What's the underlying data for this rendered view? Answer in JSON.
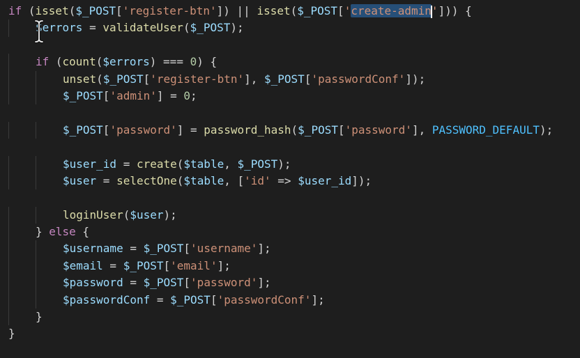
{
  "theme": {
    "background": "#1e1e1e",
    "keyword": "#c586c0",
    "function": "#dcdcaa",
    "variable": "#9cdcfe",
    "string": "#ce9178",
    "number": "#b5cea8",
    "constant": "#4fc1ff",
    "selection": "#264f78"
  },
  "cursor_icon": "text-ibeam-cursor-icon",
  "lines": [
    {
      "indent": 0,
      "tokens": [
        {
          "t": "kw",
          "v": "if"
        },
        {
          "t": "punc",
          "v": " ("
        },
        {
          "t": "fn",
          "v": "isset"
        },
        {
          "t": "punc",
          "v": "("
        },
        {
          "t": "var",
          "v": "$_POST"
        },
        {
          "t": "punc",
          "v": "["
        },
        {
          "t": "str",
          "v": "'register-btn'"
        },
        {
          "t": "punc",
          "v": "]) || "
        },
        {
          "t": "fn",
          "v": "isset"
        },
        {
          "t": "punc",
          "v": "("
        },
        {
          "t": "var",
          "v": "$_POST"
        },
        {
          "t": "punc",
          "v": "["
        },
        {
          "t": "str",
          "v": "'"
        },
        {
          "t": "sel",
          "v": "create-admin"
        },
        {
          "t": "caret",
          "v": ""
        },
        {
          "t": "str",
          "v": "'"
        },
        {
          "t": "punc",
          "v": "])) {"
        }
      ]
    },
    {
      "indent": 1,
      "tokens": [
        {
          "t": "var",
          "v": "$errors"
        },
        {
          "t": "punc",
          "v": " = "
        },
        {
          "t": "fn",
          "v": "validateUser"
        },
        {
          "t": "punc",
          "v": "("
        },
        {
          "t": "var",
          "v": "$_POST"
        },
        {
          "t": "punc",
          "v": ");"
        }
      ]
    },
    {
      "indent": 0,
      "tokens": []
    },
    {
      "indent": 1,
      "tokens": [
        {
          "t": "kw",
          "v": "if"
        },
        {
          "t": "punc",
          "v": " ("
        },
        {
          "t": "fn",
          "v": "count"
        },
        {
          "t": "punc",
          "v": "("
        },
        {
          "t": "var",
          "v": "$errors"
        },
        {
          "t": "punc",
          "v": ") === "
        },
        {
          "t": "num",
          "v": "0"
        },
        {
          "t": "punc",
          "v": ") {"
        }
      ]
    },
    {
      "indent": 2,
      "tokens": [
        {
          "t": "fn",
          "v": "unset"
        },
        {
          "t": "punc",
          "v": "("
        },
        {
          "t": "var",
          "v": "$_POST"
        },
        {
          "t": "punc",
          "v": "["
        },
        {
          "t": "str",
          "v": "'register-btn'"
        },
        {
          "t": "punc",
          "v": "], "
        },
        {
          "t": "var",
          "v": "$_POST"
        },
        {
          "t": "punc",
          "v": "["
        },
        {
          "t": "str",
          "v": "'passwordConf'"
        },
        {
          "t": "punc",
          "v": "]);"
        }
      ]
    },
    {
      "indent": 2,
      "tokens": [
        {
          "t": "var",
          "v": "$_POST"
        },
        {
          "t": "punc",
          "v": "["
        },
        {
          "t": "str",
          "v": "'admin'"
        },
        {
          "t": "punc",
          "v": "] = "
        },
        {
          "t": "num",
          "v": "0"
        },
        {
          "t": "punc",
          "v": ";"
        }
      ]
    },
    {
      "indent": 0,
      "tokens": []
    },
    {
      "indent": 2,
      "tokens": [
        {
          "t": "var",
          "v": "$_POST"
        },
        {
          "t": "punc",
          "v": "["
        },
        {
          "t": "str",
          "v": "'password'"
        },
        {
          "t": "punc",
          "v": "] = "
        },
        {
          "t": "fn",
          "v": "password_hash"
        },
        {
          "t": "punc",
          "v": "("
        },
        {
          "t": "var",
          "v": "$_POST"
        },
        {
          "t": "punc",
          "v": "["
        },
        {
          "t": "str",
          "v": "'password'"
        },
        {
          "t": "punc",
          "v": "], "
        },
        {
          "t": "const",
          "v": "PASSWORD_DEFAULT"
        },
        {
          "t": "punc",
          "v": ");"
        }
      ]
    },
    {
      "indent": 0,
      "tokens": []
    },
    {
      "indent": 2,
      "tokens": [
        {
          "t": "var",
          "v": "$user_id"
        },
        {
          "t": "punc",
          "v": " = "
        },
        {
          "t": "fn",
          "v": "create"
        },
        {
          "t": "punc",
          "v": "("
        },
        {
          "t": "var",
          "v": "$table"
        },
        {
          "t": "punc",
          "v": ", "
        },
        {
          "t": "var",
          "v": "$_POST"
        },
        {
          "t": "punc",
          "v": ");"
        }
      ]
    },
    {
      "indent": 2,
      "tokens": [
        {
          "t": "var",
          "v": "$user"
        },
        {
          "t": "punc",
          "v": " = "
        },
        {
          "t": "fn",
          "v": "selectOne"
        },
        {
          "t": "punc",
          "v": "("
        },
        {
          "t": "var",
          "v": "$table"
        },
        {
          "t": "punc",
          "v": ", ["
        },
        {
          "t": "str",
          "v": "'id'"
        },
        {
          "t": "punc",
          "v": " => "
        },
        {
          "t": "var",
          "v": "$user_id"
        },
        {
          "t": "punc",
          "v": "]);"
        }
      ]
    },
    {
      "indent": 0,
      "tokens": []
    },
    {
      "indent": 2,
      "tokens": [
        {
          "t": "fn",
          "v": "loginUser"
        },
        {
          "t": "punc",
          "v": "("
        },
        {
          "t": "var",
          "v": "$user"
        },
        {
          "t": "punc",
          "v": ");"
        }
      ]
    },
    {
      "indent": 1,
      "tokens": [
        {
          "t": "punc",
          "v": "} "
        },
        {
          "t": "kw",
          "v": "else"
        },
        {
          "t": "punc",
          "v": " {"
        }
      ]
    },
    {
      "indent": 2,
      "tokens": [
        {
          "t": "var",
          "v": "$username"
        },
        {
          "t": "punc",
          "v": " = "
        },
        {
          "t": "var",
          "v": "$_POST"
        },
        {
          "t": "punc",
          "v": "["
        },
        {
          "t": "str",
          "v": "'username'"
        },
        {
          "t": "punc",
          "v": "];"
        }
      ]
    },
    {
      "indent": 2,
      "tokens": [
        {
          "t": "var",
          "v": "$email"
        },
        {
          "t": "punc",
          "v": " = "
        },
        {
          "t": "var",
          "v": "$_POST"
        },
        {
          "t": "punc",
          "v": "["
        },
        {
          "t": "str",
          "v": "'email'"
        },
        {
          "t": "punc",
          "v": "];"
        }
      ]
    },
    {
      "indent": 2,
      "tokens": [
        {
          "t": "var",
          "v": "$password"
        },
        {
          "t": "punc",
          "v": " = "
        },
        {
          "t": "var",
          "v": "$_POST"
        },
        {
          "t": "punc",
          "v": "["
        },
        {
          "t": "str",
          "v": "'password'"
        },
        {
          "t": "punc",
          "v": "];"
        }
      ]
    },
    {
      "indent": 2,
      "tokens": [
        {
          "t": "var",
          "v": "$passwordConf"
        },
        {
          "t": "punc",
          "v": " = "
        },
        {
          "t": "var",
          "v": "$_POST"
        },
        {
          "t": "punc",
          "v": "["
        },
        {
          "t": "str",
          "v": "'passwordConf'"
        },
        {
          "t": "punc",
          "v": "];"
        }
      ]
    },
    {
      "indent": 1,
      "tokens": [
        {
          "t": "punc",
          "v": "}"
        }
      ]
    },
    {
      "indent": 0,
      "tokens": [
        {
          "t": "punc",
          "v": "}"
        }
      ]
    }
  ]
}
